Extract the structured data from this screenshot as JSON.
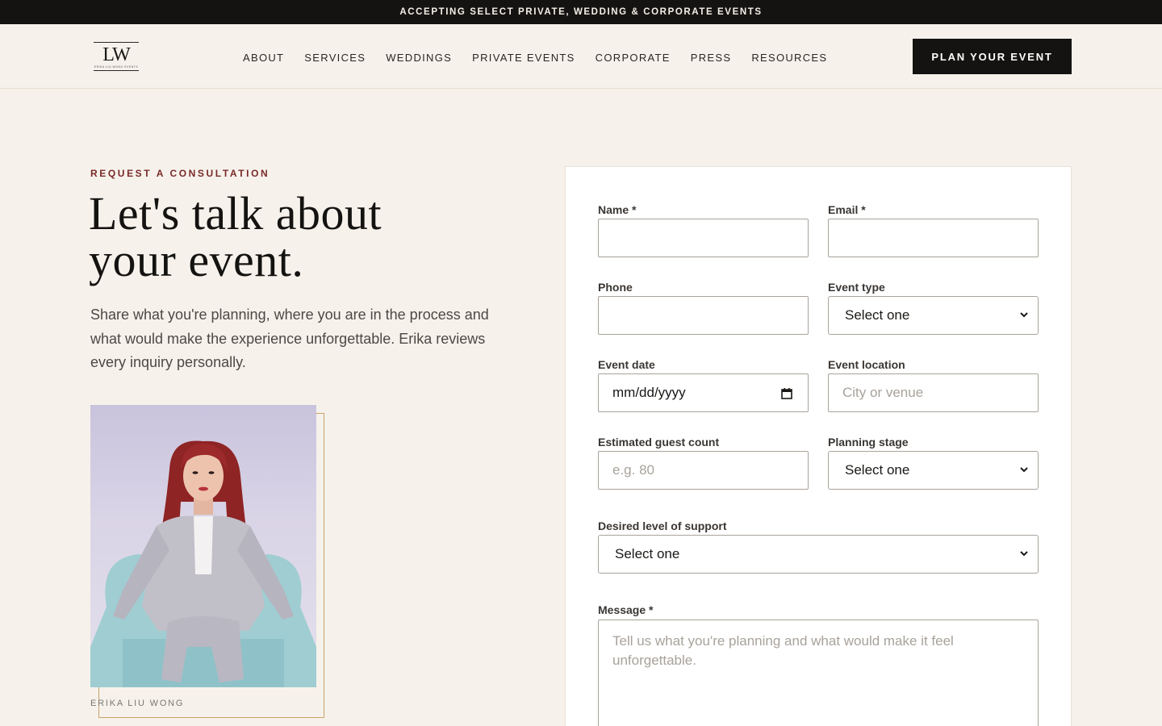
{
  "announcement": "ACCEPTING SELECT PRIVATE, WEDDING & CORPORATE EVENTS",
  "logo": {
    "monogram": "LW",
    "tagline": "ERIKA LIU WONG EVENTS"
  },
  "nav": {
    "items": [
      {
        "label": "ABOUT"
      },
      {
        "label": "SERVICES"
      },
      {
        "label": "WEDDINGS"
      },
      {
        "label": "PRIVATE EVENTS"
      },
      {
        "label": "CORPORATE"
      },
      {
        "label": "PRESS"
      },
      {
        "label": "RESOURCES"
      }
    ],
    "cta_label": "PLAN YOUR EVENT"
  },
  "hero": {
    "eyebrow": "REQUEST A CONSULTATION",
    "headline_line1": "Let's talk about",
    "headline_line2": "your event.",
    "intro": "Share what you're planning, where you are in the process and what would make the experience unforgettable. Erika reviews every inquiry personally.",
    "photo_caption": "ERIKA LIU WONG"
  },
  "form": {
    "name": {
      "label": "Name *",
      "value": ""
    },
    "email": {
      "label": "Email *",
      "value": ""
    },
    "phone": {
      "label": "Phone",
      "value": ""
    },
    "event_type": {
      "label": "Event type",
      "selected": "Select one"
    },
    "event_date": {
      "label": "Event date",
      "value": "mm/dd/yyyy"
    },
    "event_location": {
      "label": "Event location",
      "placeholder": "City or venue"
    },
    "guest_count": {
      "label": "Estimated guest count",
      "placeholder": "e.g. 80"
    },
    "planning_stage": {
      "label": "Planning stage",
      "selected": "Select one"
    },
    "support_level": {
      "label": "Desired level of support",
      "selected": "Select one"
    },
    "message": {
      "label": "Message *",
      "placeholder": "Tell us what you're planning and what would make it feel unforgettable."
    }
  },
  "colors": {
    "background": "#f6f2eb",
    "dark": "#151311",
    "eyebrow": "#7a2a2a",
    "frame_gold": "#c9a36b"
  }
}
